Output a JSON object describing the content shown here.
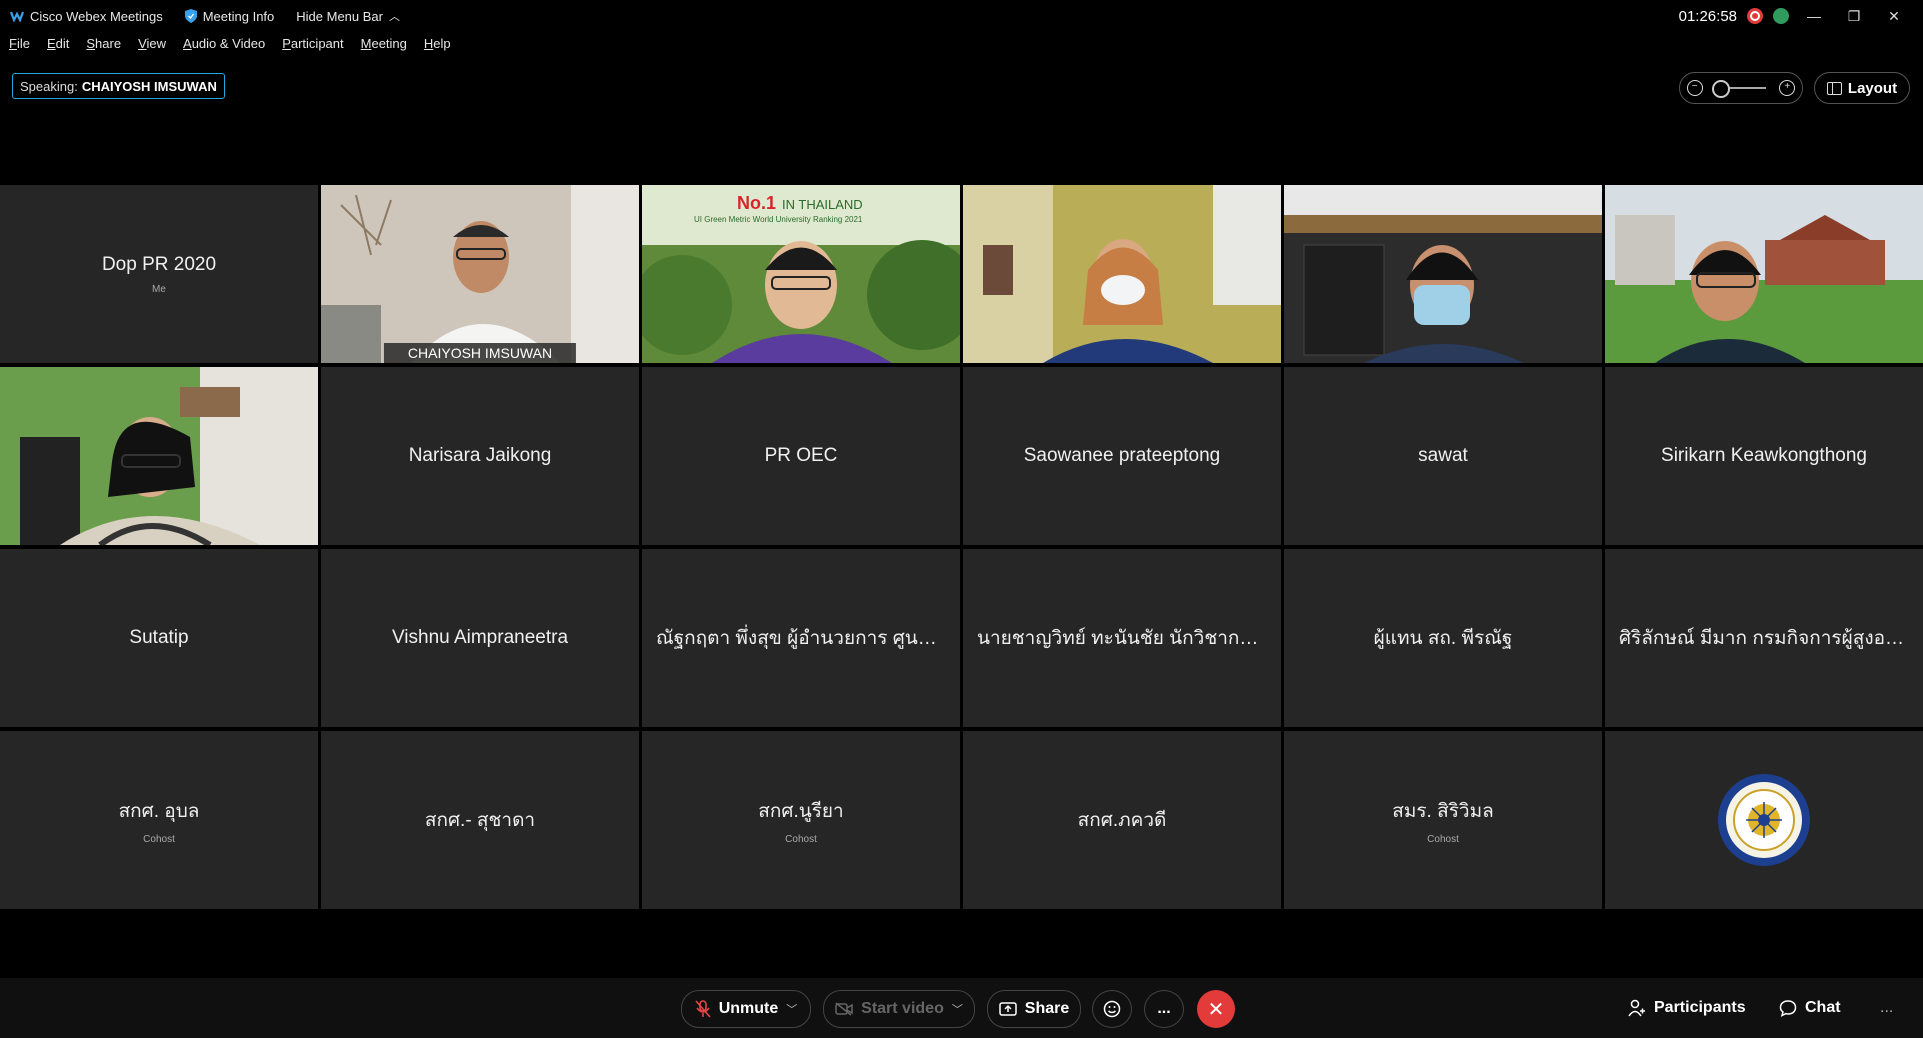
{
  "titlebar": {
    "app_name": "Cisco Webex Meetings",
    "meeting_info": "Meeting Info",
    "hide_menu_bar": "Hide Menu Bar",
    "clock": "01:26:58"
  },
  "menu": [
    "File",
    "Edit",
    "Share",
    "View",
    "Audio & Video",
    "Participant",
    "Meeting",
    "Help"
  ],
  "speaking": {
    "label": "Speaking:",
    "name": "CHAIYOSH IMSUWAN"
  },
  "layout_button": "Layout",
  "participants": [
    {
      "name": "Dop PR 2020",
      "sub": "Me",
      "video": false
    },
    {
      "name": "CHAIYOSH IMSUWAN",
      "video": true,
      "active": true
    },
    {
      "name": "",
      "video": true
    },
    {
      "name": "",
      "video": true
    },
    {
      "name": "",
      "video": true
    },
    {
      "name": "",
      "video": true
    },
    {
      "name": "",
      "video": true
    },
    {
      "name": "Narisara Jaikong",
      "video": false
    },
    {
      "name": "PR OEC",
      "video": false
    },
    {
      "name": "Saowanee prateeptong",
      "video": false
    },
    {
      "name": "sawat",
      "video": false
    },
    {
      "name": "Sirikarn Keawkongthong",
      "video": false
    },
    {
      "name": "Sutatip",
      "video": false
    },
    {
      "name": "Vishnu Aimpraneetra",
      "video": false
    },
    {
      "name": "ณัฐกฤตา พึ่งสุข ผู้อำนวยการ ศูนย์ ...",
      "video": false
    },
    {
      "name": "นายชาญวิทย์ ทะนันชัย นักวิชาการแ...",
      "video": false
    },
    {
      "name": "ผู้แทน สถ. พีรณัฐ",
      "video": false
    },
    {
      "name": "ศิริลักษณ์ มีมาก กรมกิจการผู้สูงอา...",
      "video": false
    },
    {
      "name": "สกศ. อุบล",
      "sub": "Cohost",
      "video": false
    },
    {
      "name": "สกศ.- สุชาดา",
      "video": false
    },
    {
      "name": "สกศ.นูรียา",
      "sub": "Cohost",
      "video": false
    },
    {
      "name": "สกศ.ภควดี",
      "video": false
    },
    {
      "name": "สมร. สิริวิมล",
      "sub": "Cohost",
      "video": false
    },
    {
      "name": "",
      "video": false,
      "logo": true
    }
  ],
  "banner": {
    "rank": "No.1",
    "rank_suffix": "IN THAILAND",
    "line": "UI Green Metric World University Ranking 2021"
  },
  "controls": {
    "unmute": "Unmute",
    "start_video": "Start video",
    "share": "Share",
    "participants": "Participants",
    "chat": "Chat",
    "more": "...",
    "overflow": "..."
  },
  "colors": {
    "accent": "#22a7e0",
    "end_call": "#e33a3a",
    "tile_bg": "#262626"
  }
}
